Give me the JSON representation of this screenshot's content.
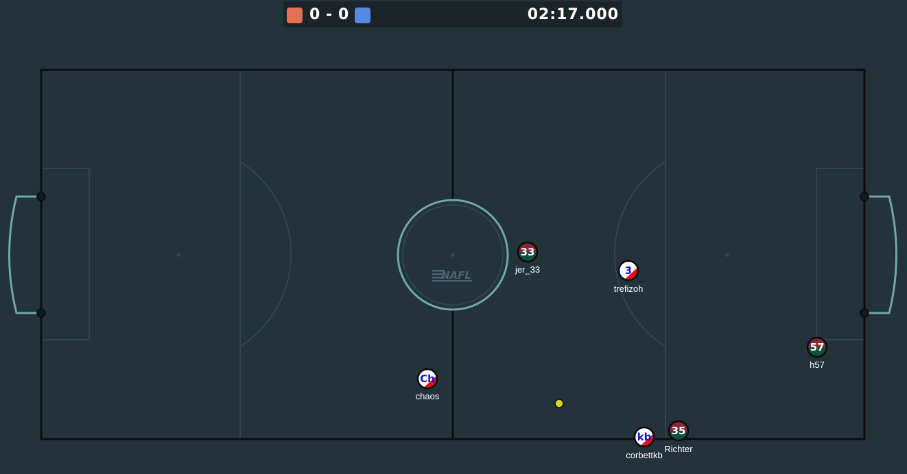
{
  "scoreboard": {
    "red_score": "0",
    "separator": "-",
    "blue_score": "0",
    "time": "02:17.000",
    "red_color": "#e56e56",
    "blue_color": "#5689e5"
  },
  "field": {
    "logo_text": "NAFL",
    "background": "#23323b",
    "line_color": "#2f4651",
    "boundary_color": "#0d0d0d",
    "goal_color": "#6fa9a5",
    "ball_color": "#d9d22b"
  },
  "players": [
    {
      "name": "jer_33",
      "avatar": "33",
      "team": "red"
    },
    {
      "name": "trefizoh",
      "avatar": "3",
      "team": "blue"
    },
    {
      "name": "h57",
      "avatar": "57",
      "team": "red"
    },
    {
      "name": "chaos",
      "avatar": "Ch",
      "team": "blue"
    },
    {
      "name": "corbettkb",
      "avatar": "kb",
      "team": "blue"
    },
    {
      "name": "Richter",
      "avatar": "35",
      "team": "red"
    }
  ]
}
